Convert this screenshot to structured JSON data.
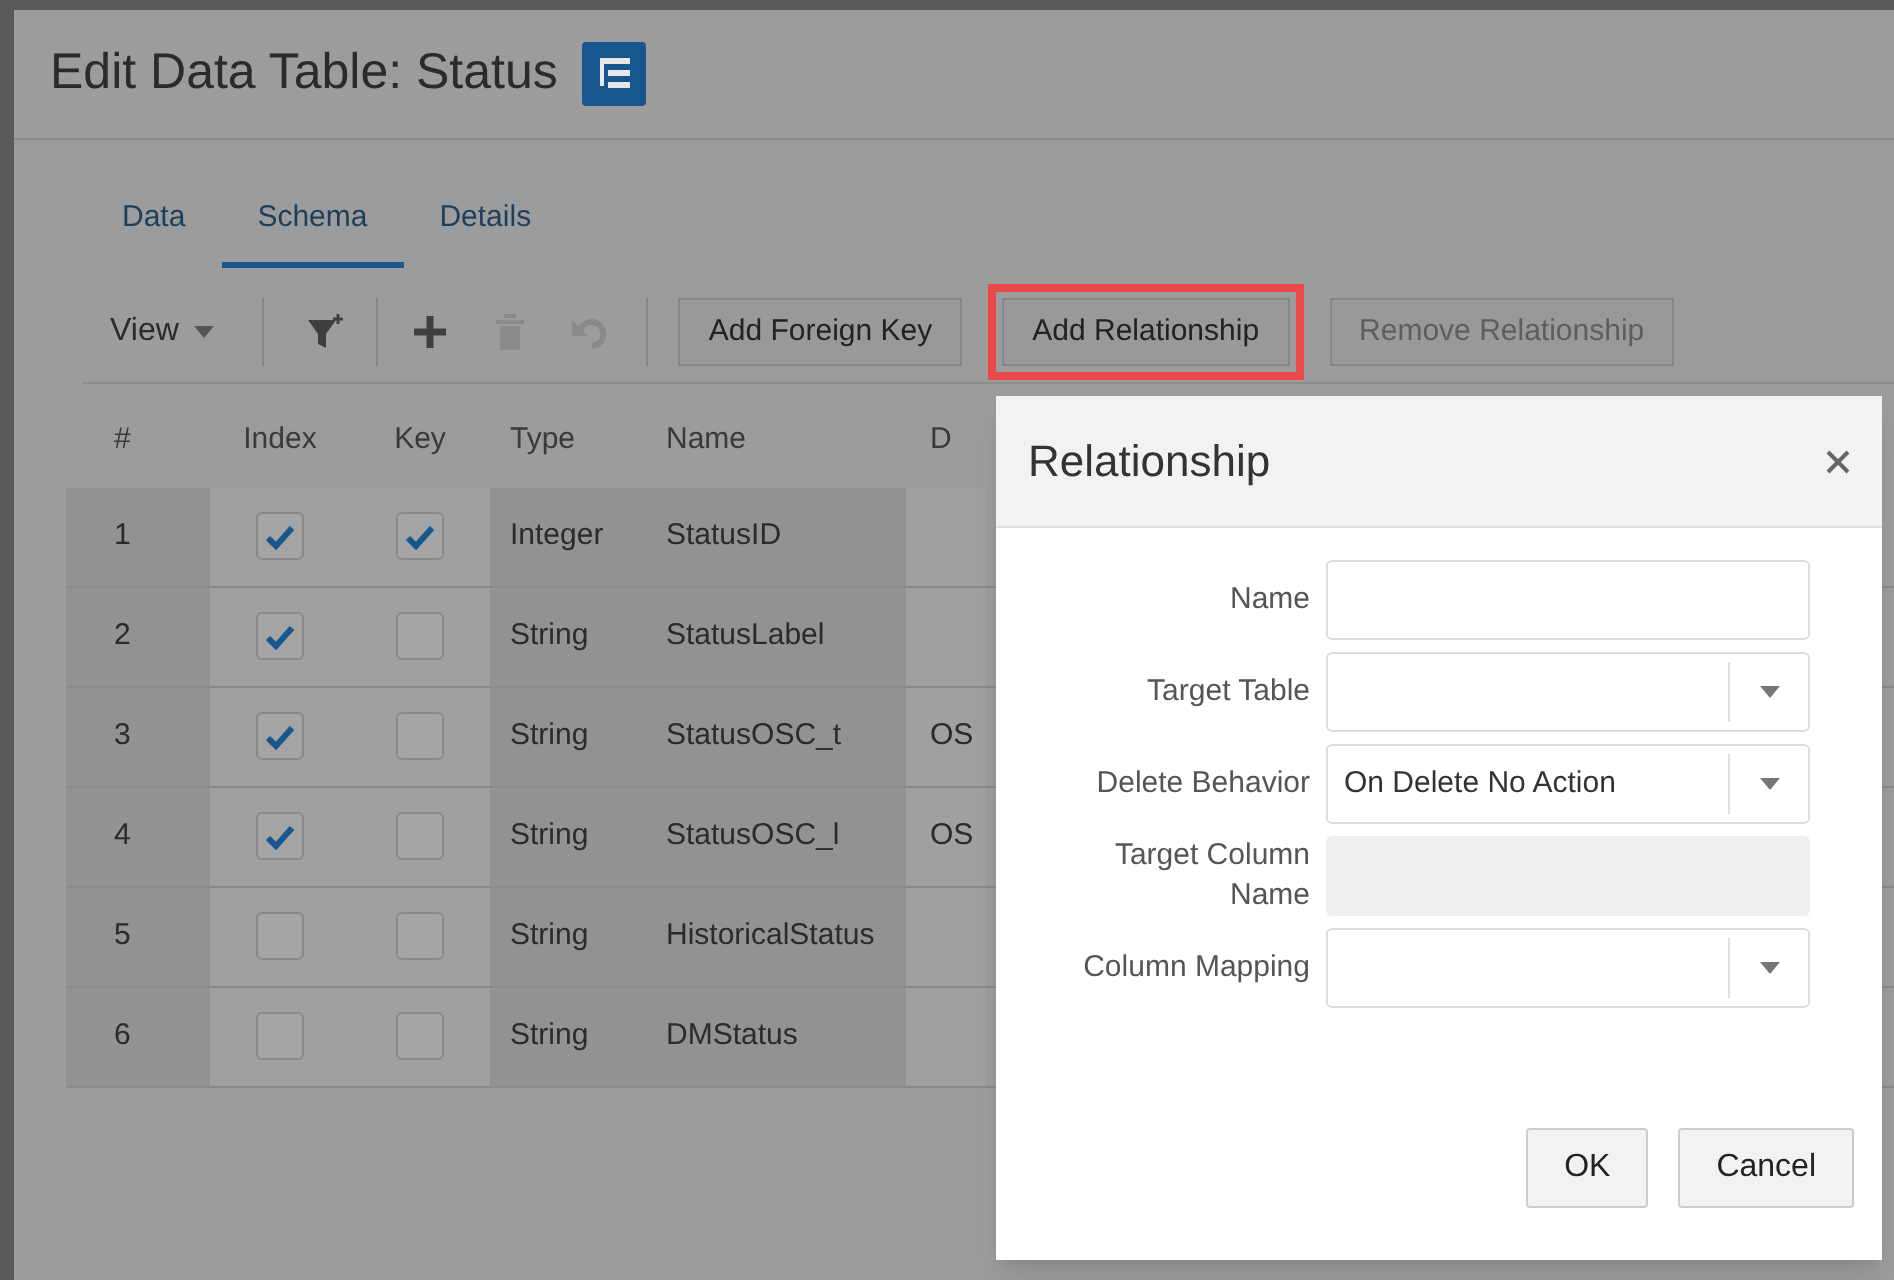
{
  "title": "Edit Data Table: Status",
  "tabs": [
    {
      "label": "Data",
      "selected": false
    },
    {
      "label": "Schema",
      "selected": true
    },
    {
      "label": "Details",
      "selected": false
    }
  ],
  "toolbar": {
    "view_menu": "View",
    "icon_buttons": [
      {
        "kind": "filter",
        "disabled": false
      },
      {
        "kind": "add",
        "disabled": false
      },
      {
        "kind": "delete",
        "disabled": true
      },
      {
        "kind": "undo",
        "disabled": true
      }
    ],
    "buttons": [
      {
        "label": "Add Foreign Key",
        "disabled": false,
        "highlighted": false
      },
      {
        "label": "Add Relationship",
        "disabled": false,
        "highlighted": true
      },
      {
        "label": "Remove Relationship",
        "disabled": true,
        "highlighted": false
      }
    ]
  },
  "table": {
    "columns": [
      "#",
      "Index",
      "Key",
      "Type",
      "Name",
      "D"
    ],
    "rows": [
      {
        "number": "1",
        "index": true,
        "key": true,
        "type": "Integer",
        "name": "StatusID"
      },
      {
        "number": "2",
        "index": true,
        "key": false,
        "type": "String",
        "name": "StatusLabel"
      },
      {
        "number": "3",
        "index": true,
        "key": false,
        "type": "String",
        "name": "StatusOSC_t",
        "column_6": "OS"
      },
      {
        "number": "4",
        "index": true,
        "key": false,
        "type": "String",
        "name": "StatusOSC_l",
        "column_6": "OS"
      },
      {
        "number": "5",
        "index": false,
        "key": false,
        "type": "String",
        "name": "HistoricalStatus"
      },
      {
        "number": "6",
        "index": false,
        "key": false,
        "type": "String",
        "name": "DMStatus"
      }
    ]
  },
  "dialog": {
    "title": "Relationship",
    "fields": [
      {
        "label": "Name",
        "kind": "text"
      },
      {
        "label": "Target Table",
        "kind": "select"
      },
      {
        "label": "Delete Behavior",
        "kind": "select",
        "value": "On Delete No Action"
      },
      {
        "label": "Target Column Name",
        "kind": "readonly"
      },
      {
        "label": "Column Mapping",
        "kind": "select"
      }
    ],
    "buttons": [
      "OK",
      "Cancel"
    ]
  }
}
